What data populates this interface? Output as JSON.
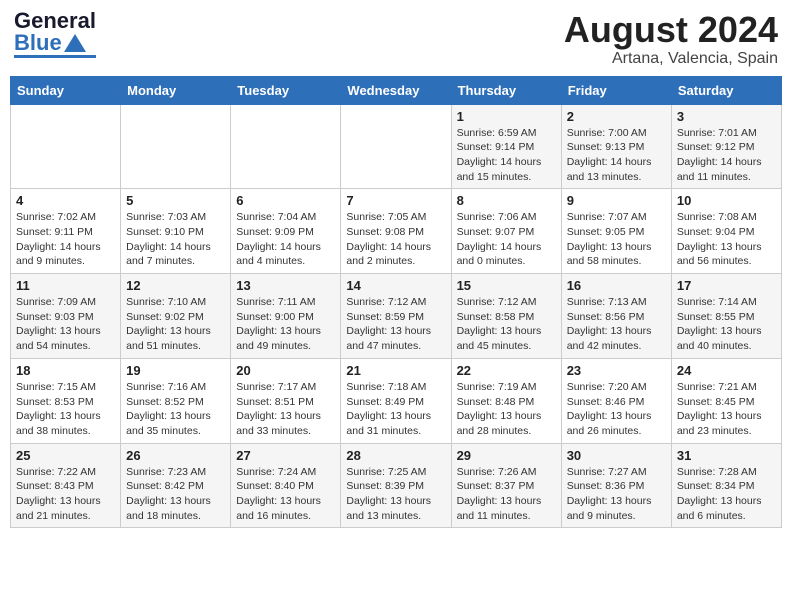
{
  "logo": {
    "general": "General",
    "blue": "Blue"
  },
  "title": {
    "month_year": "August 2024",
    "location": "Artana, Valencia, Spain"
  },
  "days_of_week": [
    "Sunday",
    "Monday",
    "Tuesday",
    "Wednesday",
    "Thursday",
    "Friday",
    "Saturday"
  ],
  "weeks": [
    [
      {
        "day": "",
        "info": ""
      },
      {
        "day": "",
        "info": ""
      },
      {
        "day": "",
        "info": ""
      },
      {
        "day": "",
        "info": ""
      },
      {
        "day": "1",
        "info": "Sunrise: 6:59 AM\nSunset: 9:14 PM\nDaylight: 14 hours\nand 15 minutes."
      },
      {
        "day": "2",
        "info": "Sunrise: 7:00 AM\nSunset: 9:13 PM\nDaylight: 14 hours\nand 13 minutes."
      },
      {
        "day": "3",
        "info": "Sunrise: 7:01 AM\nSunset: 9:12 PM\nDaylight: 14 hours\nand 11 minutes."
      }
    ],
    [
      {
        "day": "4",
        "info": "Sunrise: 7:02 AM\nSunset: 9:11 PM\nDaylight: 14 hours\nand 9 minutes."
      },
      {
        "day": "5",
        "info": "Sunrise: 7:03 AM\nSunset: 9:10 PM\nDaylight: 14 hours\nand 7 minutes."
      },
      {
        "day": "6",
        "info": "Sunrise: 7:04 AM\nSunset: 9:09 PM\nDaylight: 14 hours\nand 4 minutes."
      },
      {
        "day": "7",
        "info": "Sunrise: 7:05 AM\nSunset: 9:08 PM\nDaylight: 14 hours\nand 2 minutes."
      },
      {
        "day": "8",
        "info": "Sunrise: 7:06 AM\nSunset: 9:07 PM\nDaylight: 14 hours\nand 0 minutes."
      },
      {
        "day": "9",
        "info": "Sunrise: 7:07 AM\nSunset: 9:05 PM\nDaylight: 13 hours\nand 58 minutes."
      },
      {
        "day": "10",
        "info": "Sunrise: 7:08 AM\nSunset: 9:04 PM\nDaylight: 13 hours\nand 56 minutes."
      }
    ],
    [
      {
        "day": "11",
        "info": "Sunrise: 7:09 AM\nSunset: 9:03 PM\nDaylight: 13 hours\nand 54 minutes."
      },
      {
        "day": "12",
        "info": "Sunrise: 7:10 AM\nSunset: 9:02 PM\nDaylight: 13 hours\nand 51 minutes."
      },
      {
        "day": "13",
        "info": "Sunrise: 7:11 AM\nSunset: 9:00 PM\nDaylight: 13 hours\nand 49 minutes."
      },
      {
        "day": "14",
        "info": "Sunrise: 7:12 AM\nSunset: 8:59 PM\nDaylight: 13 hours\nand 47 minutes."
      },
      {
        "day": "15",
        "info": "Sunrise: 7:12 AM\nSunset: 8:58 PM\nDaylight: 13 hours\nand 45 minutes."
      },
      {
        "day": "16",
        "info": "Sunrise: 7:13 AM\nSunset: 8:56 PM\nDaylight: 13 hours\nand 42 minutes."
      },
      {
        "day": "17",
        "info": "Sunrise: 7:14 AM\nSunset: 8:55 PM\nDaylight: 13 hours\nand 40 minutes."
      }
    ],
    [
      {
        "day": "18",
        "info": "Sunrise: 7:15 AM\nSunset: 8:53 PM\nDaylight: 13 hours\nand 38 minutes."
      },
      {
        "day": "19",
        "info": "Sunrise: 7:16 AM\nSunset: 8:52 PM\nDaylight: 13 hours\nand 35 minutes."
      },
      {
        "day": "20",
        "info": "Sunrise: 7:17 AM\nSunset: 8:51 PM\nDaylight: 13 hours\nand 33 minutes."
      },
      {
        "day": "21",
        "info": "Sunrise: 7:18 AM\nSunset: 8:49 PM\nDaylight: 13 hours\nand 31 minutes."
      },
      {
        "day": "22",
        "info": "Sunrise: 7:19 AM\nSunset: 8:48 PM\nDaylight: 13 hours\nand 28 minutes."
      },
      {
        "day": "23",
        "info": "Sunrise: 7:20 AM\nSunset: 8:46 PM\nDaylight: 13 hours\nand 26 minutes."
      },
      {
        "day": "24",
        "info": "Sunrise: 7:21 AM\nSunset: 8:45 PM\nDaylight: 13 hours\nand 23 minutes."
      }
    ],
    [
      {
        "day": "25",
        "info": "Sunrise: 7:22 AM\nSunset: 8:43 PM\nDaylight: 13 hours\nand 21 minutes."
      },
      {
        "day": "26",
        "info": "Sunrise: 7:23 AM\nSunset: 8:42 PM\nDaylight: 13 hours\nand 18 minutes."
      },
      {
        "day": "27",
        "info": "Sunrise: 7:24 AM\nSunset: 8:40 PM\nDaylight: 13 hours\nand 16 minutes."
      },
      {
        "day": "28",
        "info": "Sunrise: 7:25 AM\nSunset: 8:39 PM\nDaylight: 13 hours\nand 13 minutes."
      },
      {
        "day": "29",
        "info": "Sunrise: 7:26 AM\nSunset: 8:37 PM\nDaylight: 13 hours\nand 11 minutes."
      },
      {
        "day": "30",
        "info": "Sunrise: 7:27 AM\nSunset: 8:36 PM\nDaylight: 13 hours\nand 9 minutes."
      },
      {
        "day": "31",
        "info": "Sunrise: 7:28 AM\nSunset: 8:34 PM\nDaylight: 13 hours\nand 6 minutes."
      }
    ]
  ]
}
